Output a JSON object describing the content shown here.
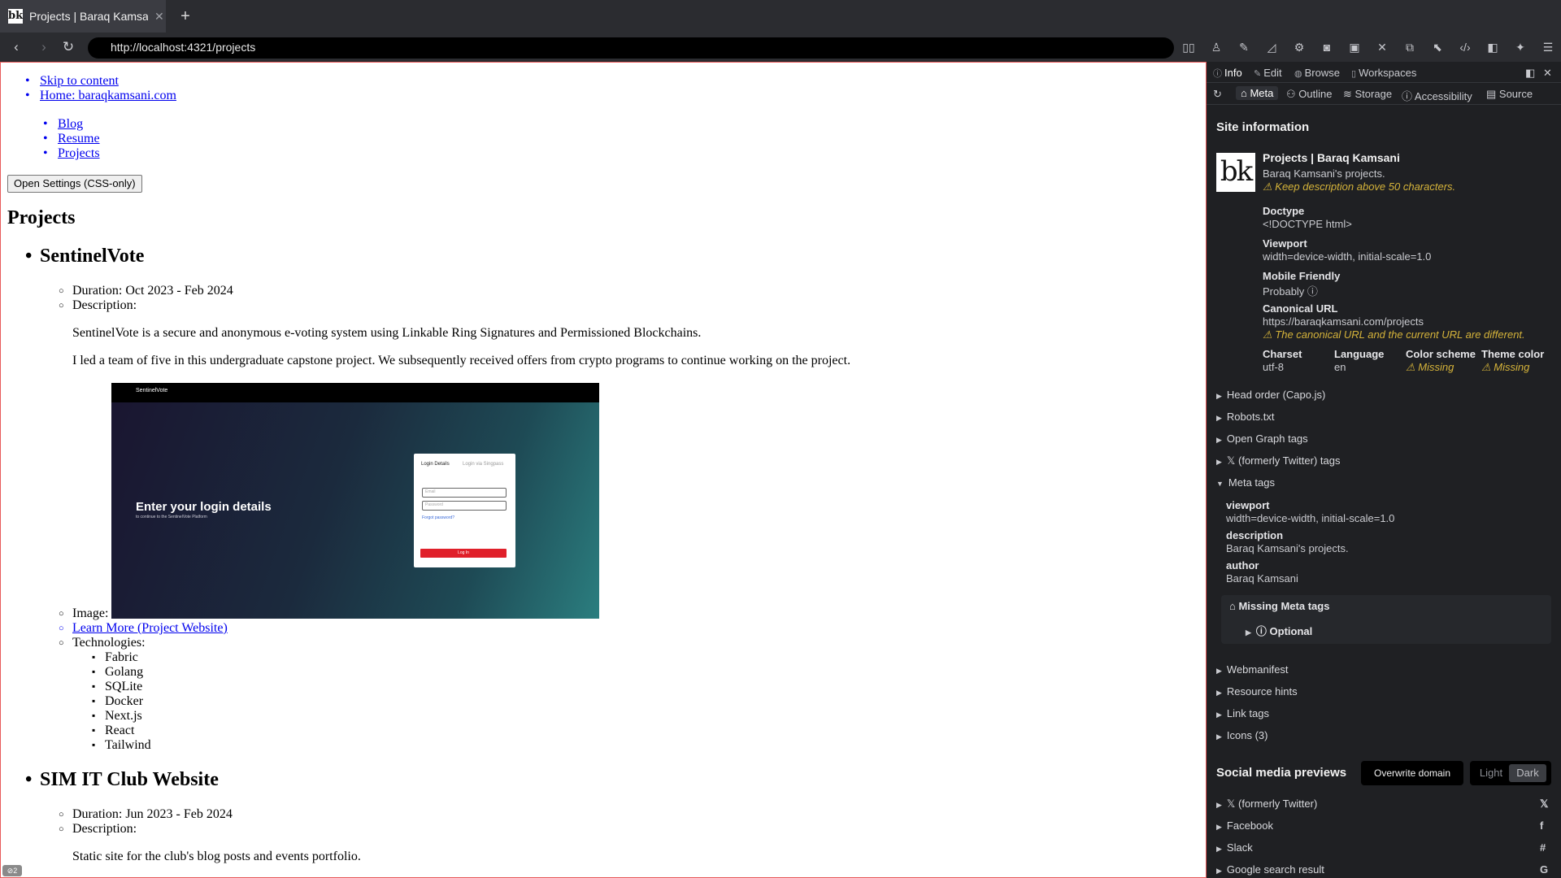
{
  "browser": {
    "tab_title": "Projects | Baraq Kamsani",
    "favicon_text": "bk",
    "new_tab": "+",
    "close_glyph": "✕",
    "url": "http://localhost:4321/projects",
    "back": "‹",
    "forward": "›",
    "reload": "↻",
    "toolbar_icons": [
      "reader-icon",
      "profile-icon",
      "pen-icon",
      "chart-icon",
      "gear-icon",
      "camera-icon",
      "image-icon",
      "tools-icon",
      "devices-icon",
      "picker-icon",
      "code-icon",
      "sidebar-icon",
      "extensions-icon",
      "settings-icon"
    ]
  },
  "page": {
    "skip_link": "Skip to content",
    "home_link": "Home: baraqkamsani.com",
    "nav": [
      "Blog",
      "Resume",
      "Projects"
    ],
    "settings_button": "Open Settings (CSS-only)",
    "heading": "Projects",
    "projects": [
      {
        "title": "SentinelVote",
        "duration": "Duration: Oct 2023 - Feb 2024",
        "description_label": "Description:",
        "description": [
          "SentinelVote is a secure and anonymous e-voting system using Linkable Ring Signatures and Permissioned Blockchains.",
          "I led a team of five in this undergraduate capstone project. We subsequently received offers from crypto programs to continue working on the project."
        ],
        "image_label": "Image:",
        "image": {
          "brand": "SentinelVote",
          "heading": "Enter your login details",
          "sub": "to continue to the SentinelVote Platform",
          "tab1": "Login Details",
          "tab2": "Login via Singpass",
          "field1": "Email",
          "field2": "Password",
          "forgot": "Forgot password?",
          "button": "Log In"
        },
        "link": "Learn More (Project Website)",
        "tech_label": "Technologies:",
        "technologies": [
          "Fabric",
          "Golang",
          "SQLite",
          "Docker",
          "Next.js",
          "React",
          "Tailwind"
        ]
      },
      {
        "title": "SIM IT Club Website",
        "duration": "Duration: Jun 2023 - Feb 2024",
        "description_label": "Description:",
        "description": [
          "Static site for the club's blog posts and events portfolio."
        ]
      }
    ],
    "error_badge": "⊘2"
  },
  "panel": {
    "tabs": [
      "Info",
      "Edit",
      "Browse",
      "Workspaces"
    ],
    "subtabs": [
      "Meta",
      "Outline",
      "Storage",
      "Accessibility",
      "Source"
    ],
    "site_info_title": "Site information",
    "logo_text": "bk",
    "site_title": "Projects | Baraq Kamsani",
    "site_desc": "Baraq Kamsani's projects.",
    "desc_warning": "Keep description above 50 characters.",
    "doctype_label": "Doctype",
    "doctype": "<!DOCTYPE html>",
    "viewport_label": "Viewport",
    "viewport": "width=device-width, initial-scale=1.0",
    "mobile_label": "Mobile Friendly",
    "mobile": "Probably",
    "canonical_label": "Canonical URL",
    "canonical": "https://baraqkamsani.com/projects",
    "canonical_warning": "The canonical URL and the current URL are different.",
    "charset_label": "Charset",
    "charset": "utf-8",
    "language_label": "Language",
    "language": "en",
    "colorscheme_label": "Color scheme",
    "colorscheme": "Missing",
    "themecolor_label": "Theme color",
    "themecolor": "Missing",
    "sections_a": [
      "Head order (Capo.js)",
      "Robots.txt",
      "Open Graph tags",
      "𝕏 (formerly Twitter) tags"
    ],
    "meta_tags_title": "Meta tags",
    "meta_tags": [
      {
        "name": "viewport",
        "value": "width=device-width, initial-scale=1.0"
      },
      {
        "name": "description",
        "value": "Baraq Kamsani's projects."
      },
      {
        "name": "author",
        "value": "Baraq Kamsani"
      }
    ],
    "missing_meta": "Missing Meta tags",
    "optional": "Optional",
    "sections_b": [
      "Webmanifest",
      "Resource hints",
      "Link tags",
      "Icons (3)"
    ],
    "social_title": "Social media previews",
    "overwrite_domain": "Overwrite domain",
    "light": "Light",
    "dark": "Dark",
    "social": [
      "𝕏 (formerly Twitter)",
      "Facebook",
      "Slack",
      "Google search result"
    ],
    "social_icons": [
      "𝕏",
      "f",
      "#",
      "G"
    ]
  }
}
